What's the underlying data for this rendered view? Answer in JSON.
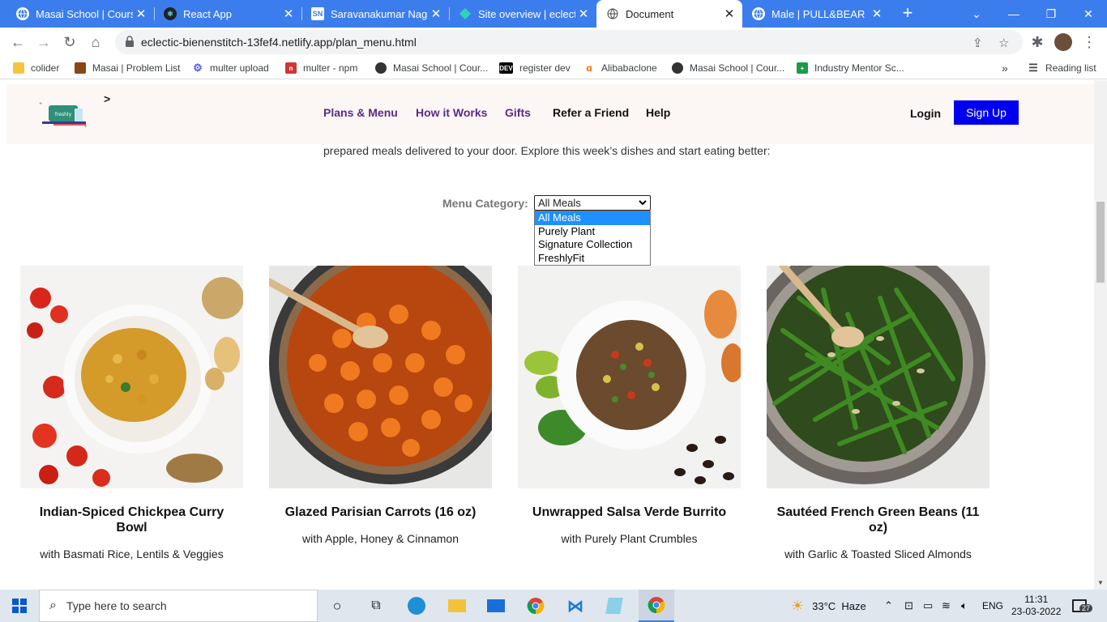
{
  "browser": {
    "tabs": [
      {
        "title": "Masai School | Course",
        "icon": "globe-icon"
      },
      {
        "title": "React App",
        "icon": "react-icon"
      },
      {
        "title": "Saravanakumar Nagar",
        "icon": "sn-icon",
        "icon_text": "SN"
      },
      {
        "title": "Site overview | eclectic",
        "icon": "netlify-icon"
      },
      {
        "title": "Document",
        "icon": "globe-icon"
      },
      {
        "title": "Male | PULL&BEAR Pu",
        "icon": "globe-icon"
      }
    ],
    "url": "eclectic-bienenstitch-13fef4.netlify.app/plan_menu.html",
    "bookmarks": [
      {
        "label": "colider",
        "icon": "folder-icon"
      },
      {
        "label": "Masai | Problem List",
        "icon": "palm-icon"
      },
      {
        "label": "multer upload",
        "icon": "gear-icon"
      },
      {
        "label": "multer - npm",
        "icon": "npm-icon"
      },
      {
        "label": "Masai School | Cour...",
        "icon": "globe-icon"
      },
      {
        "label": "register dev",
        "icon": "dev-icon",
        "icon_text": "DEV"
      },
      {
        "label": "Alibabaclone",
        "icon": "alibaba-icon"
      },
      {
        "label": "Masai School | Cour...",
        "icon": "globe-icon"
      },
      {
        "label": "Industry Mentor Sc...",
        "icon": "plus-icon"
      }
    ],
    "overflow": "»",
    "reading_list": "Reading list"
  },
  "site": {
    "logo_text": "freshly",
    "logo_arrow": ">",
    "nav": [
      "Plans & Menu",
      "How it Works",
      "Gifts",
      "Refer a Friend",
      "Help"
    ],
    "login": "Login",
    "signup": "Sign Up",
    "intro": "prepared meals delivered to your door. Explore this week’s dishes and start eating better:",
    "category_label": "Menu Category:",
    "category_selected": "All Meals",
    "category_options": [
      "All Meals",
      "Purely Plant",
      "Signature Collection",
      "FreshlyFit"
    ],
    "meals": [
      {
        "name": "Indian-Spiced Chickpea Curry Bowl",
        "sub": "with Basmati Rice, Lentils & Veggies"
      },
      {
        "name": "Glazed Parisian Carrots (16 oz)",
        "sub": "with Apple, Honey & Cinnamon"
      },
      {
        "name": "Unwrapped Salsa Verde Burrito",
        "sub": "with Purely Plant Crumbles"
      },
      {
        "name": "Sautéed French Green Beans (11 oz)",
        "sub": "with Garlic & Toasted Sliced Almonds"
      }
    ]
  },
  "taskbar": {
    "search_placeholder": "Type here to search",
    "weather": "33°C  Haze",
    "lang": "ENG",
    "time": "11:31",
    "date": "23-03-2022",
    "notifications": "27"
  },
  "colors": {
    "tabstrip": "#3b7ded",
    "nav_purple": "#5b2a86",
    "signup_blue": "#0000ee",
    "header_bg": "#fcf7f5"
  }
}
